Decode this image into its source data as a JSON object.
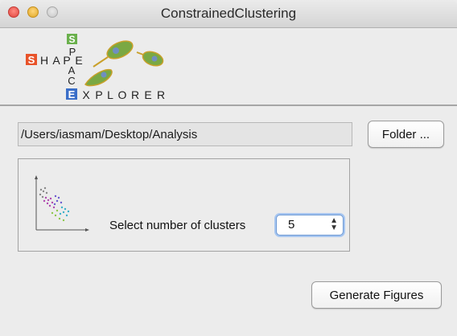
{
  "window": {
    "title": "ConstrainedClustering"
  },
  "logo": {
    "row_letters": [
      "S",
      "H",
      "A",
      "P",
      "E"
    ],
    "col_letters": [
      "S",
      "P",
      "A",
      "C",
      "E"
    ],
    "last_row_letters": [
      "E",
      "X",
      "P",
      "L",
      "O",
      "R",
      "E",
      "R"
    ],
    "colors": {
      "orange": "#e8532a",
      "green": "#6ab04c",
      "blue": "#3a6ec8",
      "cell_green": "#7aa843",
      "cell_core": "#6f8fc0"
    }
  },
  "folder": {
    "path_value": "/Users/iasmam/Desktop/Analysis",
    "button_label": "Folder ..."
  },
  "clusters": {
    "label": "Select number of clusters",
    "selected_value": "5"
  },
  "actions": {
    "generate_label": "Generate Figures"
  },
  "colors": {
    "focus_ring": "#a7c6f0",
    "window_bg": "#ececec"
  }
}
